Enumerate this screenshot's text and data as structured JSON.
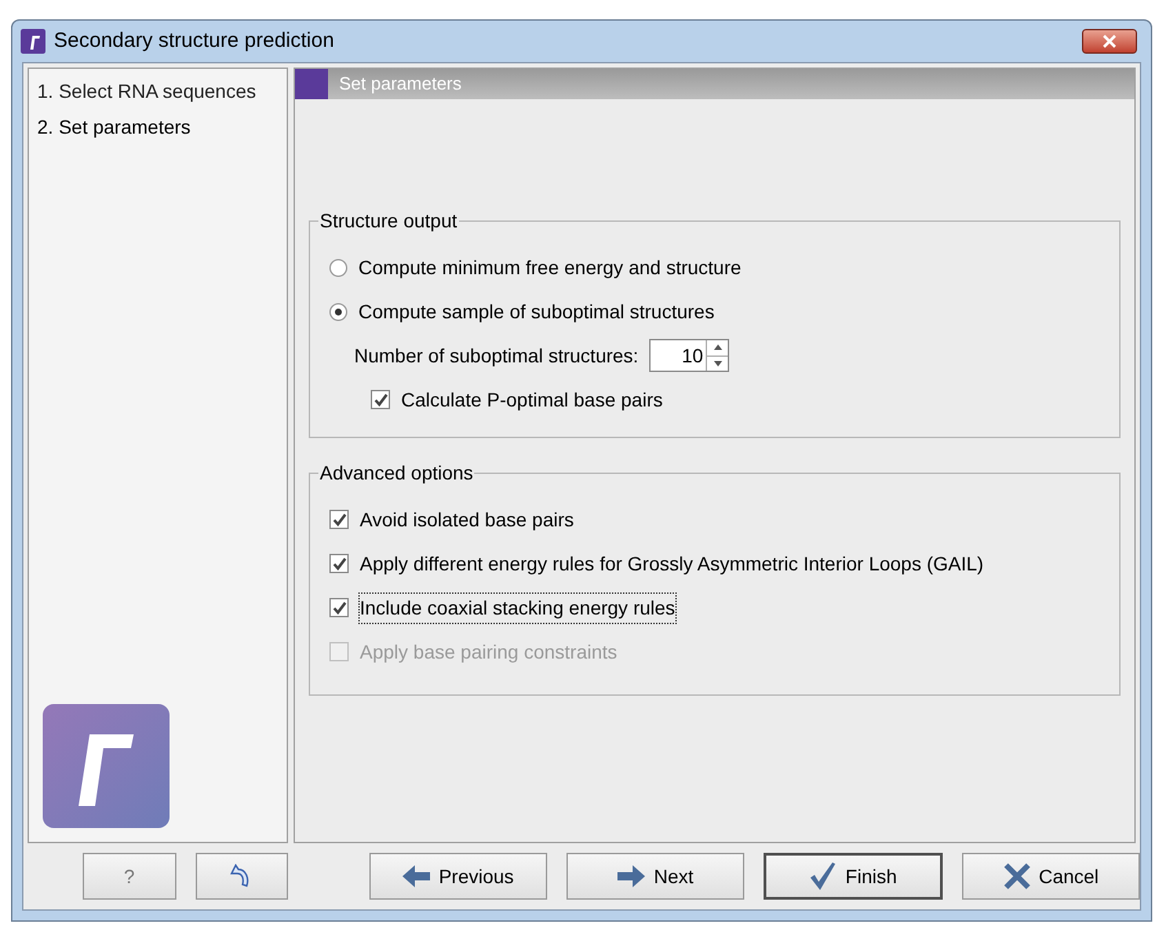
{
  "window": {
    "title": "Secondary structure prediction"
  },
  "steps": [
    {
      "label": "1. Select RNA sequences",
      "selected": false
    },
    {
      "label": "2. Set parameters",
      "selected": true
    }
  ],
  "panel_title": "Set parameters",
  "structure_output": {
    "title": "Structure output",
    "options": [
      {
        "kind": "radio",
        "label": "Compute minimum free energy and structure",
        "selected": false
      },
      {
        "kind": "radio",
        "label": "Compute sample of suboptimal structures",
        "selected": true
      },
      {
        "kind": "spinner",
        "label": "Number of suboptimal structures:",
        "value": "10"
      },
      {
        "kind": "checkbox",
        "label": "Calculate P-optimal base pairs",
        "checked": true,
        "disabled": false
      }
    ]
  },
  "advanced_options": {
    "title": "Advanced options",
    "options": [
      {
        "kind": "checkbox",
        "label": "Avoid isolated base pairs",
        "checked": true,
        "disabled": false,
        "focused": false
      },
      {
        "kind": "checkbox",
        "label": "Apply different energy rules for Grossly Asymmetric Interior Loops (GAIL)",
        "checked": true,
        "disabled": false,
        "focused": false
      },
      {
        "kind": "checkbox",
        "label": "Include coaxial stacking energy rules",
        "checked": true,
        "disabled": false,
        "focused": true
      },
      {
        "kind": "checkbox",
        "label": "Apply base pairing constraints",
        "checked": false,
        "disabled": true,
        "focused": false
      }
    ]
  },
  "buttons": [
    {
      "kind": "help",
      "label": "?"
    },
    {
      "kind": "reset"
    },
    {
      "kind": "previous",
      "label": "Previous"
    },
    {
      "kind": "next",
      "label": "Next"
    },
    {
      "kind": "finish",
      "label": "Finish",
      "default": true
    },
    {
      "kind": "cancel",
      "label": "Cancel"
    }
  ]
}
